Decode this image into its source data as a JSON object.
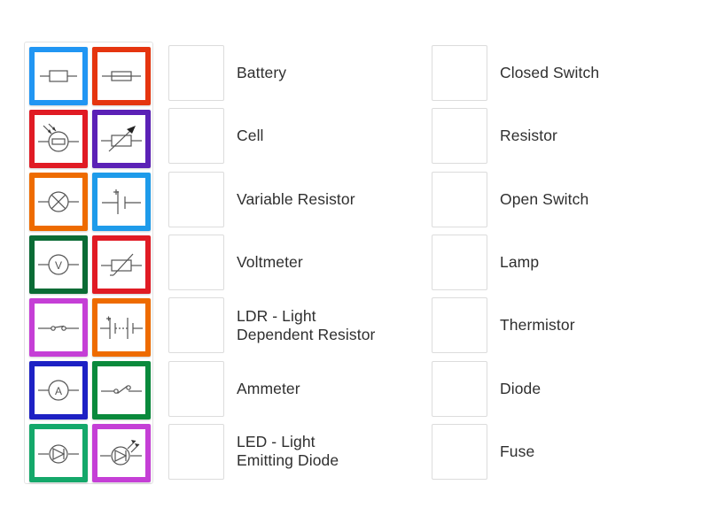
{
  "activity": {
    "type": "match-up-drag-and-drop",
    "topic": "Circuit Symbols"
  },
  "tile_tray": {
    "name": "draggable-symbol-tiles",
    "tiles": [
      {
        "symbol": "resistor",
        "icon": "resistor-icon",
        "border_color": "#2196f3"
      },
      {
        "symbol": "fuse",
        "icon": "fuse-icon",
        "border_color": "#e5350f"
      },
      {
        "symbol": "ldr",
        "icon": "ldr-icon",
        "border_color": "#e01b24"
      },
      {
        "symbol": "variable-resistor",
        "icon": "variable-resistor-icon",
        "border_color": "#5b21b6"
      },
      {
        "symbol": "lamp",
        "icon": "lamp-icon",
        "border_color": "#ee6b00"
      },
      {
        "symbol": "cell",
        "icon": "cell-icon",
        "border_color": "#1e9bea"
      },
      {
        "symbol": "voltmeter",
        "icon": "voltmeter-icon",
        "border_color": "#0a6b35"
      },
      {
        "symbol": "thermistor",
        "icon": "thermistor-icon",
        "border_color": "#e01b24"
      },
      {
        "symbol": "open-switch",
        "icon": "open-switch-icon",
        "border_color": "#c53fd6"
      },
      {
        "symbol": "battery",
        "icon": "battery-icon",
        "border_color": "#ee6b00"
      },
      {
        "symbol": "ammeter",
        "icon": "ammeter-icon",
        "border_color": "#1d21c4"
      },
      {
        "symbol": "closed-switch",
        "icon": "closed-switch-icon",
        "border_color": "#0a8a3c"
      },
      {
        "symbol": "diode",
        "icon": "diode-icon",
        "border_color": "#14a86a"
      },
      {
        "symbol": "led",
        "icon": "led-icon",
        "border_color": "#c53fd6"
      }
    ]
  },
  "answers": {
    "left_column": [
      {
        "label": "Battery"
      },
      {
        "label": "Cell"
      },
      {
        "label": "Variable Resistor"
      },
      {
        "label": "Voltmeter"
      },
      {
        "label": "LDR - Light\nDependent Resistor"
      },
      {
        "label": "Ammeter"
      },
      {
        "label": "LED - Light\nEmitting Diode"
      }
    ],
    "right_column": [
      {
        "label": "Closed Switch"
      },
      {
        "label": "Resistor"
      },
      {
        "label": "Open Switch"
      },
      {
        "label": "Lamp"
      },
      {
        "label": "Thermistor"
      },
      {
        "label": "Diode"
      },
      {
        "label": "Fuse"
      }
    ]
  },
  "drop_box": {
    "placeholder_state": "empty"
  }
}
